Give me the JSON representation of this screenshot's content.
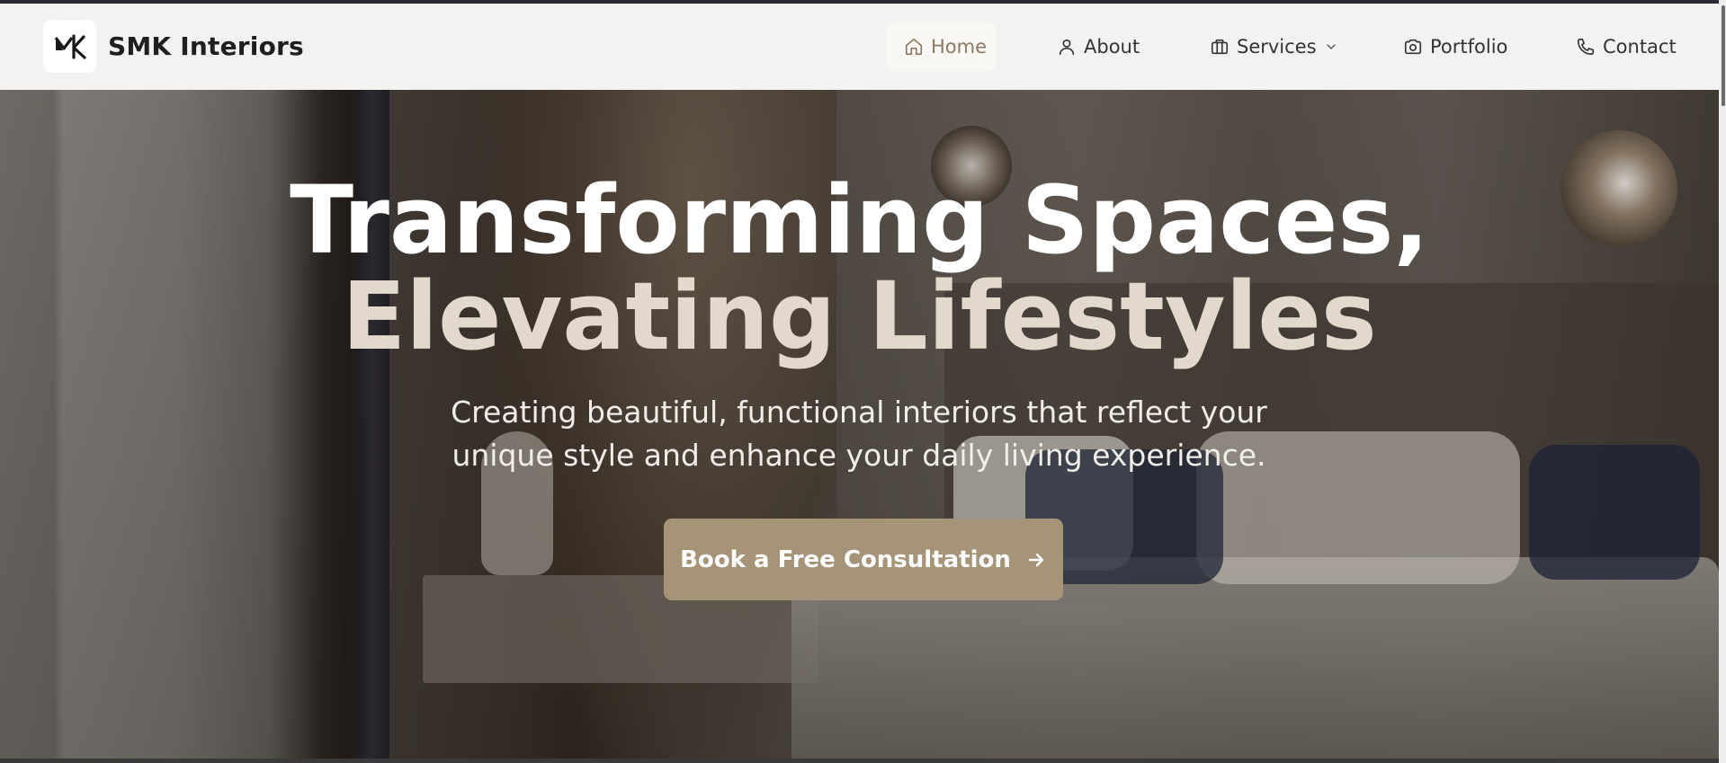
{
  "brand": {
    "name": "SMK Interiors",
    "logo_text": "MK"
  },
  "nav": {
    "items": [
      {
        "label": "Home",
        "icon": "home-icon",
        "active": true
      },
      {
        "label": "About",
        "icon": "user-icon",
        "active": false
      },
      {
        "label": "Services",
        "icon": "briefcase-icon",
        "active": false,
        "has_dropdown": true
      },
      {
        "label": "Portfolio",
        "icon": "camera-icon",
        "active": false
      },
      {
        "label": "Contact",
        "icon": "phone-icon",
        "active": false
      }
    ]
  },
  "hero": {
    "title_line1": "Transforming Spaces,",
    "title_line2": "Elevating Lifestyles",
    "subtitle": "Creating beautiful, functional interiors that reflect your unique style and enhance your daily living experience.",
    "cta_label": "Book a Free Consultation",
    "cta_icon": "arrow-right-icon"
  },
  "colors": {
    "accent": "#a69478",
    "active_nav_text": "#8b7963",
    "title_secondary": "#e2d8cb"
  }
}
